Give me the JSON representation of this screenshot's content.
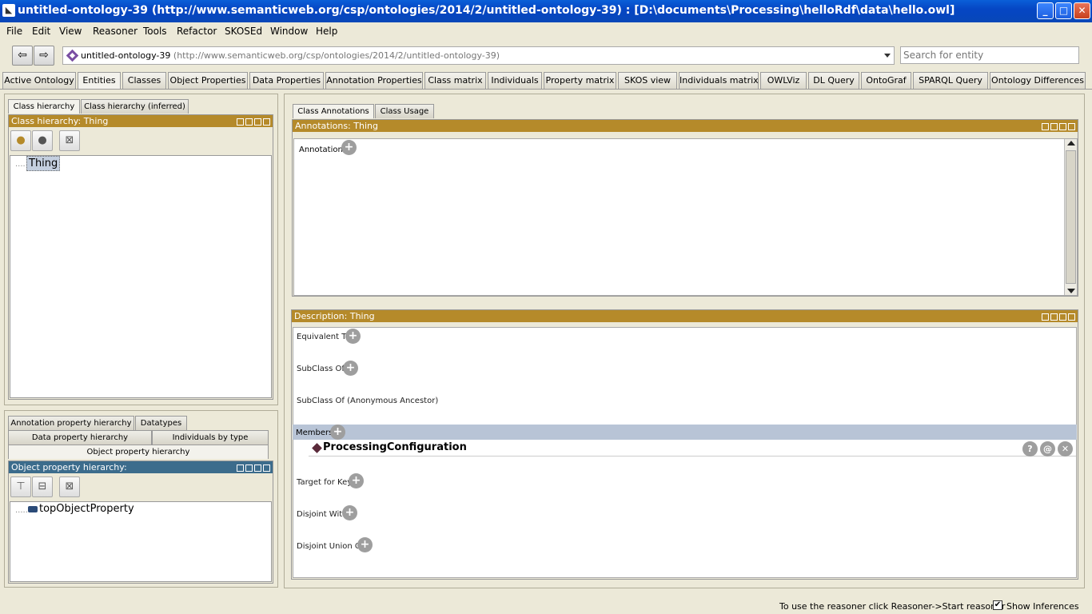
{
  "window": {
    "title": "untitled-ontology-39 (http://www.semanticweb.org/csp/ontologies/2014/2/untitled-ontology-39)  : [D:\\documents\\Processing\\helloRdf\\data\\hello.owl]",
    "minimize": "_",
    "maximize": "□",
    "close": "✕"
  },
  "menu": [
    "File",
    "Edit",
    "View",
    "Reasoner",
    "Tools",
    "Refactor",
    "SKOSEd",
    "Window",
    "Help"
  ],
  "nav": {
    "back": "⇦",
    "forward": "⇨",
    "ontology_name": "untitled-ontology-39",
    "ontology_iri": "(http://www.semanticweb.org/csp/ontologies/2014/2/untitled-ontology-39)",
    "search_placeholder": "Search for entity"
  },
  "tabs": [
    "Active Ontology",
    "Entities",
    "Classes",
    "Object Properties",
    "Data Properties",
    "Annotation Properties",
    "Class matrix",
    "Individuals",
    "Property matrix",
    "SKOS view",
    "Individuals matrix",
    "OWLViz",
    "DL Query",
    "OntoGraf",
    "SPARQL Query",
    "Ontology Differences"
  ],
  "active_tab": "Entities",
  "left": {
    "class_tabs": [
      "Class hierarchy",
      "Class hierarchy (inferred)"
    ],
    "class_header": "Class hierarchy: Thing",
    "class_root": "Thing",
    "prop_tabs_row1": [
      "Annotation property hierarchy",
      "Datatypes"
    ],
    "prop_tabs_row2": [
      "Data property hierarchy",
      "Individuals by type"
    ],
    "prop_tab_active": "Object property hierarchy",
    "prop_header": "Object property hierarchy:",
    "prop_root": "topObjectProperty"
  },
  "right": {
    "ann_tabs": [
      "Class Annotations",
      "Class Usage"
    ],
    "ann_header": "Annotations: Thing",
    "annotations_label": "Annotations",
    "desc_header": "Description: Thing",
    "equivalent_to": "Equivalent To",
    "subclass_of": "SubClass Of",
    "subclass_anon": "SubClass Of (Anonymous Ancestor)",
    "members": "Members",
    "member_item": "ProcessingConfiguration",
    "target_for_key": "Target for Key",
    "disjoint_with": "Disjoint With",
    "disjoint_union_of": "Disjoint Union Of",
    "plus": "+",
    "help_btn": "?",
    "annotate_btn": "@",
    "delete_btn": "✕"
  },
  "status": {
    "message": "To use the reasoner click Reasoner->Start reasoner",
    "show_inferences": "Show Inferences",
    "show_inferences_checked": "✔"
  }
}
